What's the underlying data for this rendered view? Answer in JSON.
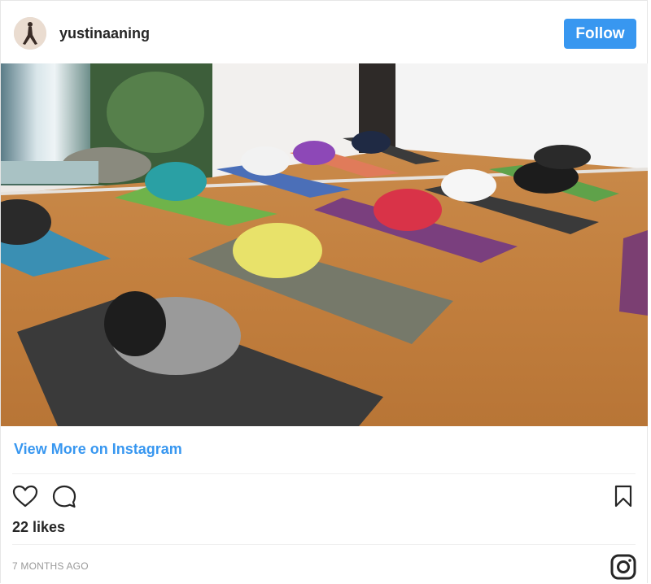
{
  "post": {
    "username": "yustinaaning",
    "follow_label": "Follow",
    "view_more_label": "View More on Instagram",
    "likes_text": "22 likes",
    "timestamp": "7 MONTHS AGO"
  },
  "icons": {
    "like": "heart-icon",
    "comment": "comment-icon",
    "save": "bookmark-icon",
    "brand": "instagram-logo-icon"
  },
  "colors": {
    "accent": "#3897f0",
    "text": "#262626",
    "muted": "#999999"
  }
}
